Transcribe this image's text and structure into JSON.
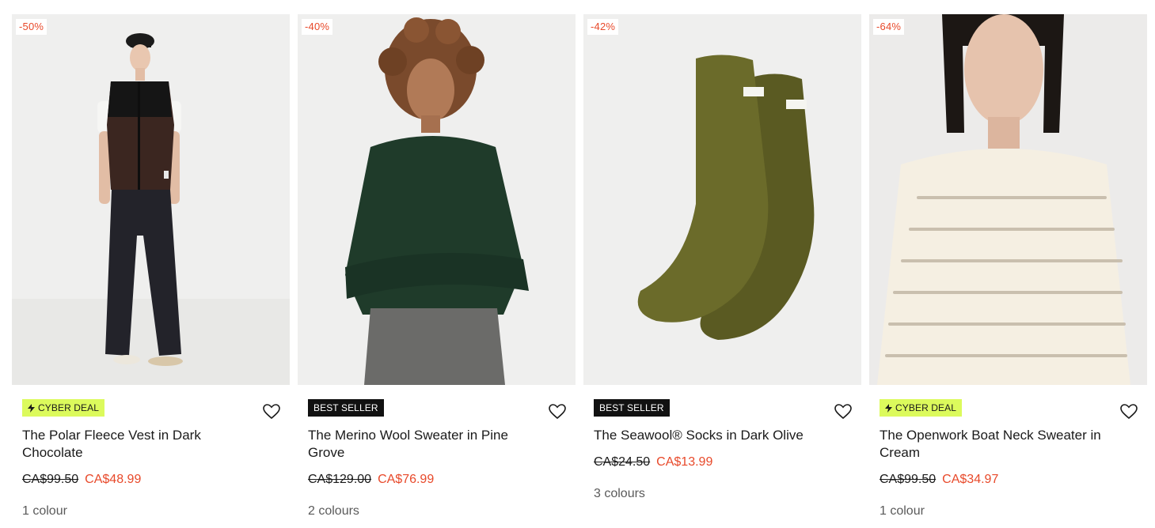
{
  "colors": {
    "sale": "#e8492a",
    "cyber_badge_bg": "#dcfa5c",
    "best_seller_bg": "#111111",
    "image_bg": "#efefee"
  },
  "products": [
    {
      "discount": "-50%",
      "badge": {
        "type": "cyber",
        "label": "CYBER DEAL",
        "icon": "lightning-bolt-icon"
      },
      "title": "The Polar Fleece Vest in Dark Chocolate",
      "old_price": "CA$99.50",
      "new_price": "CA$48.99",
      "colours": "1 colour",
      "image": "model-in-fleece-vest-and-wide-leg-pants"
    },
    {
      "discount": "-40%",
      "badge": {
        "type": "best",
        "label": "BEST SELLER"
      },
      "title": "The Merino Wool Sweater in Pine Grove",
      "old_price": "CA$129.00",
      "new_price": "CA$76.99",
      "colours": "2 colours",
      "image": "model-in-green-cable-knit-sweater"
    },
    {
      "discount": "-42%",
      "badge": {
        "type": "best",
        "label": "BEST SELLER"
      },
      "title": "The Seawool® Socks in Dark Olive",
      "old_price": "CA$24.50",
      "new_price": "CA$13.99",
      "colours": "3 colours",
      "image": "pair-of-olive-socks"
    },
    {
      "discount": "-64%",
      "badge": {
        "type": "cyber",
        "label": "CYBER DEAL",
        "icon": "lightning-bolt-icon"
      },
      "title": "The Openwork Boat Neck Sweater in Cream",
      "old_price": "CA$99.50",
      "new_price": "CA$34.97",
      "colours": "1 colour",
      "image": "model-in-cream-openwork-sweater"
    }
  ]
}
